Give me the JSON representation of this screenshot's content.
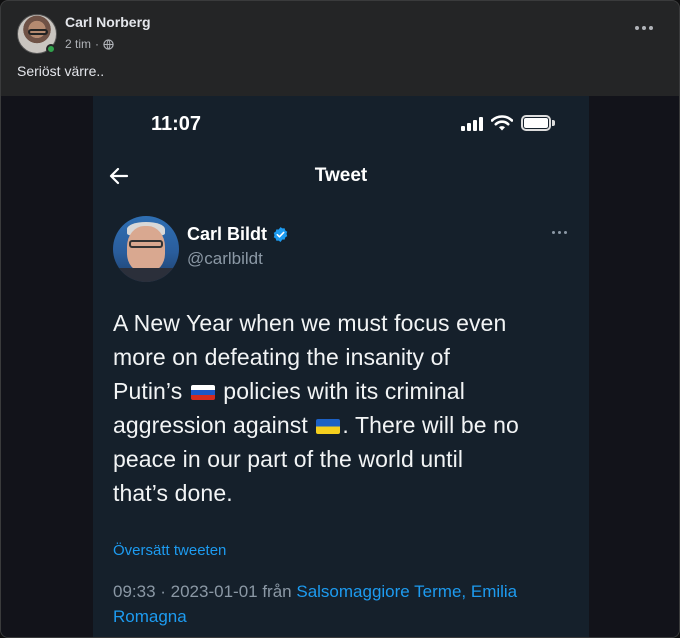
{
  "facebook_post": {
    "author_name": "Carl Norberg",
    "time": "2 tim",
    "separator": "·",
    "text": "Seriöst värre..",
    "icons": {
      "more": "more-horizontal-icon",
      "audience": "globe-icon"
    },
    "colors": {
      "background": "#242526",
      "online": "#31a24c"
    }
  },
  "phone_status": {
    "clock": "11:07",
    "icons": [
      "signal-icon",
      "wifi-icon",
      "battery-icon"
    ]
  },
  "twitter_nav": {
    "back_icon": "arrow-left-icon",
    "title": "Tweet"
  },
  "tweet": {
    "author_name": "Carl Bildt",
    "handle": "@carlbildt",
    "verified": true,
    "body_lines": [
      {
        "before": "A New Year when we must focus even"
      },
      {
        "before": "more on defeating the insanity of"
      },
      {
        "before": "Putin’s ",
        "flag": "russia-flag",
        "after": " policies with its criminal"
      },
      {
        "before": "aggression against ",
        "flag": "ukraine-flag",
        "after": ". There will be no"
      },
      {
        "before": "peace in our part of the world until"
      },
      {
        "before": "that’s done."
      }
    ],
    "translate_link": "Översätt tweeten",
    "timestamp": "09:33 · 2023-01-01 från ",
    "location": "Salsomaggiore Terme, Emilia Romagna",
    "colors": {
      "background": "#15202b",
      "link": "#1d9bf0",
      "muted": "#8b98a5"
    }
  }
}
